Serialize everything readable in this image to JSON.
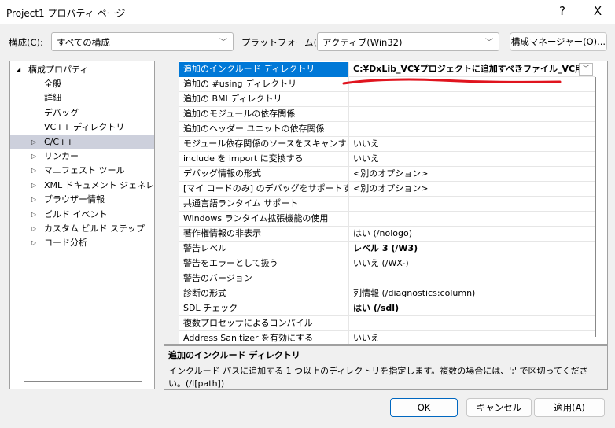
{
  "window": {
    "title": "Project1 プロパティ ページ",
    "help": "?",
    "close": "X"
  },
  "toolbar": {
    "config_label": "構成(C):",
    "config_value": "すべての構成",
    "platform_label": "プラットフォーム(P):",
    "platform_value": "アクティブ(Win32)",
    "config_manager": "構成マネージャー(O)..."
  },
  "tree": {
    "root": "構成プロパティ",
    "items": [
      "全般",
      "詳細",
      "デバッグ",
      "VC++ ディレクトリ",
      "C/C++",
      "リンカー",
      "マニフェスト ツール",
      "XML ドキュメント ジェネレーター",
      "ブラウザー情報",
      "ビルド イベント",
      "カスタム ビルド ステップ",
      "コード分析"
    ]
  },
  "grid": {
    "rows": [
      {
        "name": "追加のインクルード ディレクトリ",
        "value": "C:¥DxLib_VC¥プロジェクトに追加すべきファイル_VC用"
      },
      {
        "name": "追加の #using ディレクトリ",
        "value": ""
      },
      {
        "name": "追加の BMI ディレクトリ",
        "value": ""
      },
      {
        "name": "追加のモジュールの依存関係",
        "value": ""
      },
      {
        "name": "追加のヘッダー ユニットの依存関係",
        "value": ""
      },
      {
        "name": "モジュール依存関係のソースをスキャンする",
        "value": "いいえ"
      },
      {
        "name": "include を import に変換する",
        "value": "いいえ"
      },
      {
        "name": "デバッグ情報の形式",
        "value": "<別のオプション>"
      },
      {
        "name": "[マイ コードのみ] のデバッグをサポートする",
        "value": "<別のオプション>"
      },
      {
        "name": "共通言語ランタイム サポート",
        "value": ""
      },
      {
        "name": "Windows ランタイム拡張機能の使用",
        "value": ""
      },
      {
        "name": "著作権情報の非表示",
        "value": "はい (/nologo)"
      },
      {
        "name": "警告レベル",
        "value": "レベル 3 (/W3)"
      },
      {
        "name": "警告をエラーとして扱う",
        "value": "いいえ (/WX-)"
      },
      {
        "name": "警告のバージョン",
        "value": ""
      },
      {
        "name": "診断の形式",
        "value": "列情報 (/diagnostics:column)"
      },
      {
        "name": "SDL チェック",
        "value": "はい (/sdl)"
      },
      {
        "name": "複数プロセッサによるコンパイル",
        "value": ""
      },
      {
        "name": "Address Sanitizer を有効にする",
        "value": "いいえ"
      }
    ]
  },
  "description": {
    "title": "追加のインクルード ディレクトリ",
    "text": "インクルード パスに追加する 1 つ以上のディレクトリを指定します。複数の場合には、';' で区切ってください。(/I[path])"
  },
  "buttons": {
    "ok": "OK",
    "cancel": "キャンセル",
    "apply": "適用(A)"
  },
  "colors": {
    "selection": "#0078d7",
    "annotation": "#e0141e"
  }
}
